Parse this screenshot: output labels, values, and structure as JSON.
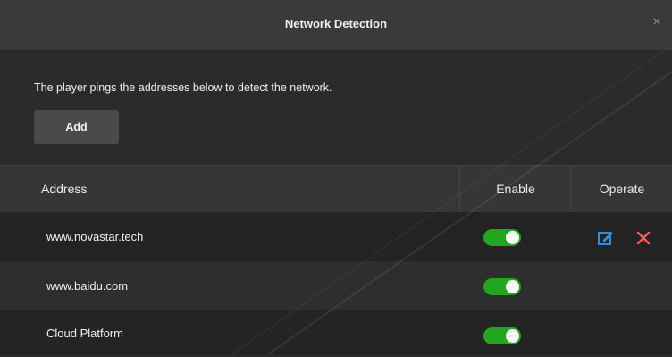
{
  "dialog": {
    "title": "Network Detection",
    "close_icon": "close-icon",
    "close_glyph": "×"
  },
  "description": "The player pings the addresses below to detect the network.",
  "add_button_label": "Add",
  "table": {
    "columns": {
      "address": "Address",
      "enable": "Enable",
      "operate": "Operate"
    },
    "rows": [
      {
        "address": "www.novastar.tech",
        "enabled": true,
        "operations": [
          "edit-icon",
          "delete-icon"
        ]
      },
      {
        "address": "www.baidu.com",
        "enabled": true,
        "operations": []
      },
      {
        "address": "Cloud Platform",
        "enabled": true,
        "operations": []
      }
    ]
  },
  "colors": {
    "background": "#2b2b2b",
    "titlebar": "#3a3a3a",
    "toggle_on": "#22a61f",
    "edit_icon": "#2e8fe0",
    "delete_icon": "#ff5b5b"
  },
  "watermark_icon": "diagonal-watermark"
}
